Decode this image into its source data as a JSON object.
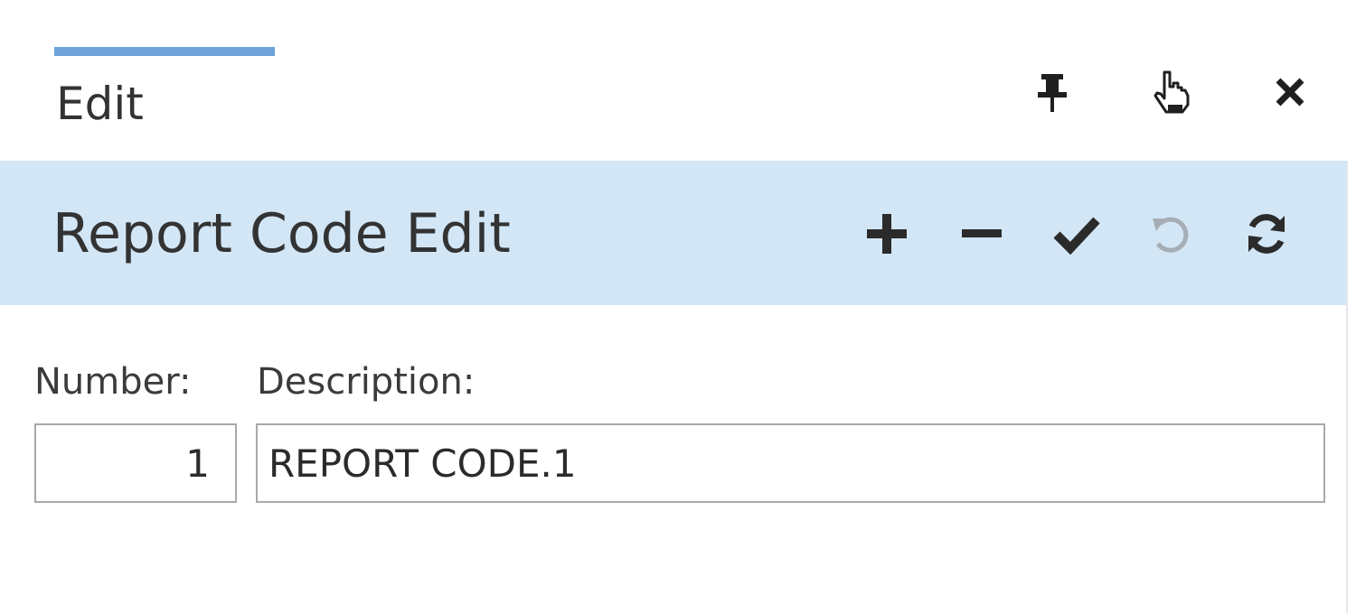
{
  "tab": {
    "label": "Edit"
  },
  "window_controls": [
    {
      "name": "pin-icon"
    },
    {
      "name": "hand-pointer-icon"
    },
    {
      "name": "close-icon"
    }
  ],
  "header": {
    "title": "Report Code Edit",
    "toolbar": [
      {
        "name": "add-icon",
        "enabled": true
      },
      {
        "name": "remove-icon",
        "enabled": true
      },
      {
        "name": "save-check-icon",
        "enabled": true
      },
      {
        "name": "undo-icon",
        "enabled": false
      },
      {
        "name": "refresh-icon",
        "enabled": true
      }
    ]
  },
  "form": {
    "number": {
      "label": "Number:",
      "value": "1"
    },
    "description": {
      "label": "Description:",
      "value": "REPORT CODE.1"
    }
  },
  "colors": {
    "header_band": "#d2e6f6",
    "tab_indicator": "#6ea3dc",
    "icon_dark": "#2b2b2b",
    "icon_disabled": "#a6adb4",
    "input_border": "#a9a9a9"
  }
}
